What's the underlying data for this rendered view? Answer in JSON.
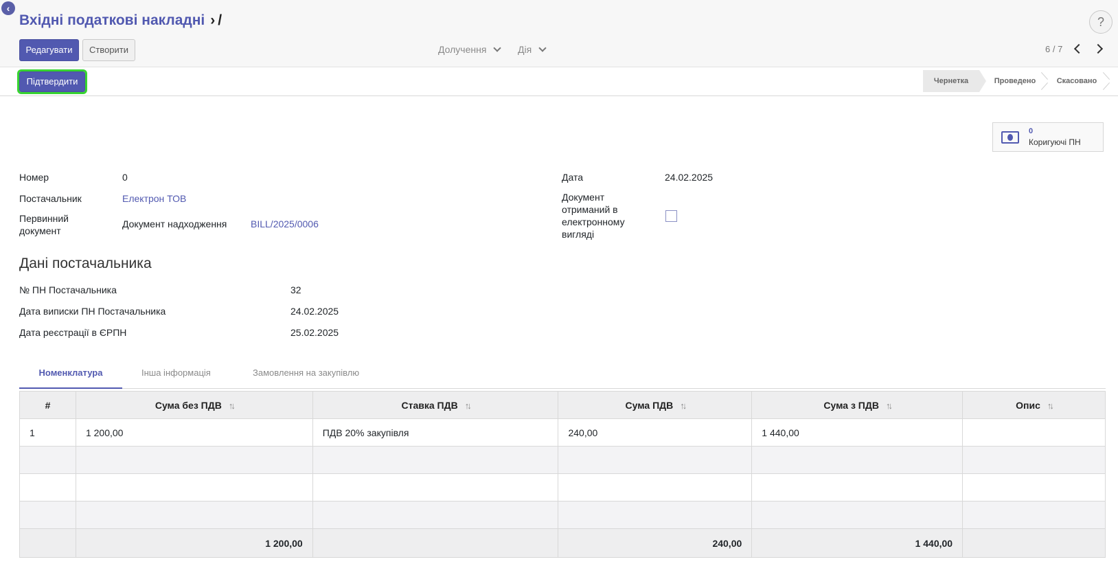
{
  "breadcrumb": {
    "parent": "Вхідні податкові накладні",
    "separator": "›",
    "current": "/"
  },
  "help_label": "?",
  "toolbar": {
    "edit_label": "Редагувати",
    "create_label": "Створити",
    "print_label": "Долучення",
    "action_label": "Дія"
  },
  "pager": {
    "value": "6 / 7"
  },
  "statusbar": {
    "confirm_label": "Підтвердити",
    "stages": [
      "Чернетка",
      "Проведено",
      "Скасовано"
    ],
    "active_stage": "Чернетка"
  },
  "smart_button": {
    "count": "0",
    "label": "Коригуючі ПН"
  },
  "form": {
    "number_label": "Номер",
    "number_value": "0",
    "vendor_label": "Постачальник",
    "vendor_value": "Електрон ТОВ",
    "primary_doc_label": "Первинний документ",
    "receipt_doc_label": "Документ надходження",
    "receipt_doc_value": "BILL/2025/0006",
    "date_label": "Дата",
    "date_value": "24.02.2025",
    "electronic_label": "Документ отриманий в електронному вигляді",
    "electronic_checked": false
  },
  "vendor_section": {
    "title": "Дані постачальника",
    "tax_no_label": "№ ПН Постачальника",
    "tax_no_value": "32",
    "issue_date_label": "Дата виписки ПН Постачальника",
    "issue_date_value": "24.02.2025",
    "reg_date_label": "Дата реєстрації в ЄРПН",
    "reg_date_value": "25.02.2025"
  },
  "tabs": [
    "Номенклатура",
    "Інша інформація",
    "Замовлення на закупівлю"
  ],
  "table": {
    "columns": [
      "#",
      "Сума без ПДВ",
      "Ставка ПДВ",
      "Сума ПДВ",
      "Сума з ПДВ",
      "Опис"
    ],
    "rows": [
      {
        "num": "1",
        "amount_untaxed": "1 200,00",
        "tax": "ПДВ 20% закупівля",
        "amount_tax": "240,00",
        "amount_total": "1 440,00",
        "description": ""
      }
    ],
    "totals": {
      "amount_untaxed": "1 200,00",
      "amount_tax": "240,00",
      "amount_total": "1 440,00"
    }
  },
  "colors": {
    "accent": "#5159b0",
    "highlight": "#38d431"
  }
}
